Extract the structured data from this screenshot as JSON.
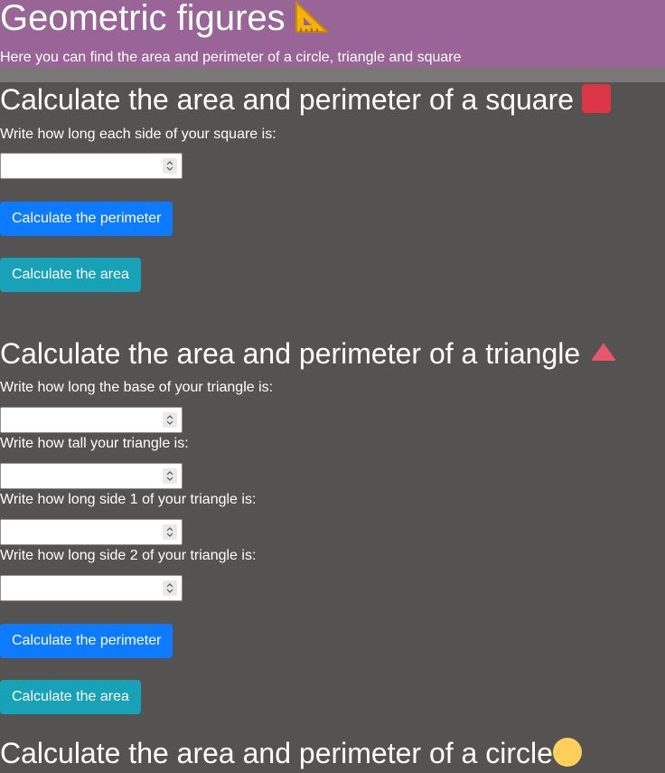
{
  "header": {
    "title": "Geometric figures",
    "subtitle": "Here you can find the area and perimeter of a circle, triangle and square"
  },
  "square": {
    "title": "Calculate the area and perimeter of a square",
    "label_side": "Write how long each side of your square is:",
    "btn_perimeter": "Calculate the perimeter",
    "btn_area": "Calculate the area"
  },
  "triangle": {
    "title": "Calculate the area and perimeter of a triangle",
    "label_base": "Write how long the base of your triangle is:",
    "label_height": "Write how tall your triangle is:",
    "label_side1": "Write how long side 1 of your triangle is:",
    "label_side2": "Write how long side 2 of your triangle is:",
    "btn_perimeter": "Calculate the perimeter",
    "btn_area": "Calculate the area"
  },
  "circle": {
    "title": "Calculate the area and perimeter of a circle"
  },
  "colors": {
    "header_bg": "#986596",
    "page_bg": "#555352",
    "primary": "#0d7bff",
    "info": "#17a2b8",
    "square_icon": "#dc3545",
    "triangle_icon": "#e8566c",
    "circle_icon": "#ffcf5c"
  },
  "icons": [
    "triangular-ruler-icon",
    "square-icon",
    "triangle-icon",
    "circle-icon"
  ]
}
